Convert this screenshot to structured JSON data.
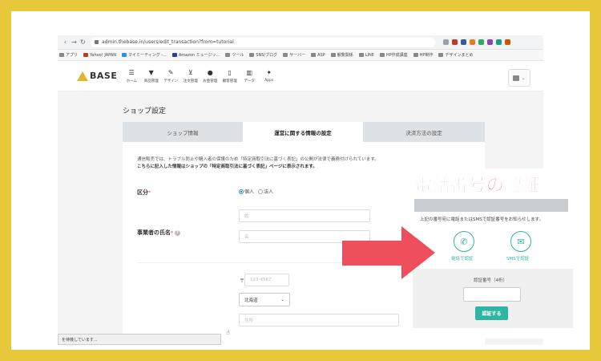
{
  "browser": {
    "url": "admin.thebase.in/users/edit_transaction?from=tutorial",
    "bookmarks": [
      "アプリ",
      "Yahoo! JAPAN",
      "マイミーティング -...",
      "Amazon ミュージッ...",
      "ツール",
      "SNS/ブログ",
      "サーバー",
      "ASP",
      "観覧関係",
      "LINE",
      "HP作成講座",
      "HP制作",
      "デザインまとめ"
    ],
    "status_text": "を待機しています..."
  },
  "header": {
    "logo": "BASE",
    "nav": [
      {
        "icon": "home-icon",
        "label": "ホーム"
      },
      {
        "icon": "shirt-icon",
        "label": "商品管理"
      },
      {
        "icon": "brush-icon",
        "label": "デザイン"
      },
      {
        "icon": "cart-icon",
        "label": "注文管理"
      },
      {
        "icon": "wallet-icon",
        "label": "お金管理"
      },
      {
        "icon": "phone-icon",
        "label": "顧客管理"
      },
      {
        "icon": "chart-icon",
        "label": "データ"
      },
      {
        "icon": "puzzle-icon",
        "label": "Apps"
      }
    ]
  },
  "page": {
    "title": "ショップ設定",
    "tabs": [
      "ショップ情報",
      "運営に関する情報の設定",
      "決済方法の設定"
    ],
    "notice_line1": "通信販売では、トラブル防止や購入者の保護のため「特定商取引法に基づく表記」の公開が法律で義務付けられています。",
    "notice_line2": "こちらに記入した情報はショップの「特定商取引法に基づく表記」ページに表示されます。",
    "kubun_label": "区分",
    "required_mark": "*",
    "radio_individual": "個人",
    "radio_corporation": "法人",
    "name_label": "事業者の氏名",
    "surname_placeholder": "姓",
    "firstname_placeholder": "名",
    "postal_mark": "〒",
    "postal_placeholder": "123-4567",
    "prefecture": "北海道",
    "address_placeholder": "住所"
  },
  "overlay": {
    "headline": "電話番号の認証",
    "description": "上記の番号宛に電話またはSMSで認証番号をお知らせします。",
    "option_call": "電話で認証",
    "option_sms": "SMSで認証",
    "code_label": "認証番号（4桁）",
    "verify_button": "認証する"
  },
  "colors": {
    "background": "#e7c83a",
    "headline": "#e84a5a",
    "accent": "#2fb5a3",
    "arrow": "#ef4e5c"
  }
}
